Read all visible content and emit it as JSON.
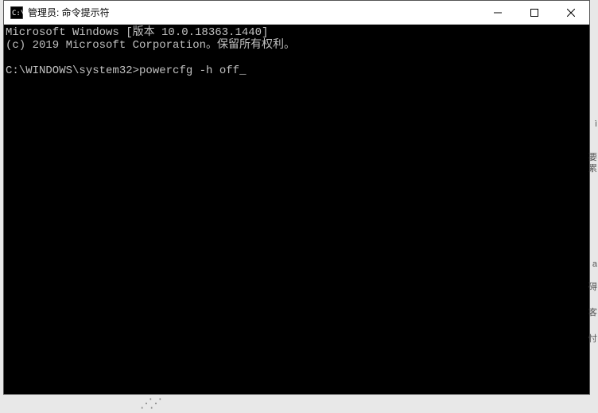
{
  "window": {
    "title": "管理员: 命令提示符"
  },
  "titlebar": {
    "minimize": "─",
    "maximize": "□",
    "close": "✕"
  },
  "terminal": {
    "line1": "Microsoft Windows [版本 10.0.18363.1440]",
    "line2": "(c) 2019 Microsoft Corporation。保留所有权利。",
    "line3": "",
    "prompt": "C:\\WINDOWS\\system32>",
    "command": "powercfg -h off",
    "cursor": "_"
  }
}
